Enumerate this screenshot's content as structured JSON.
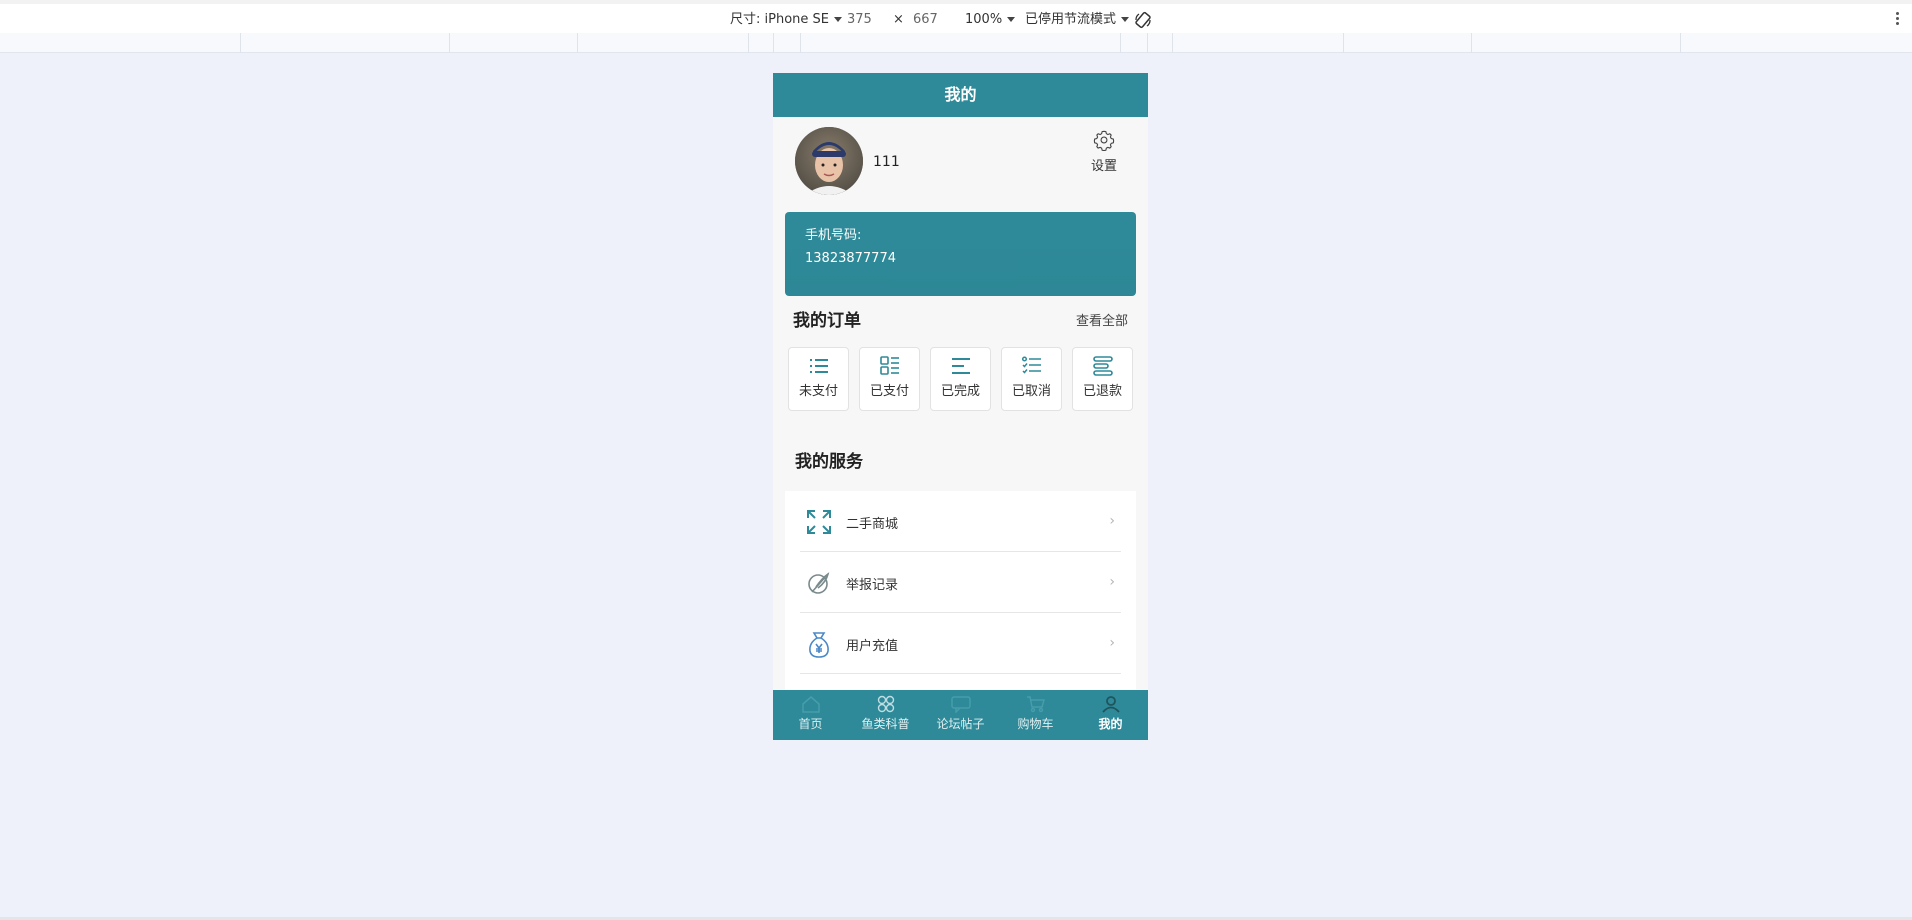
{
  "devtools": {
    "device_label": "尺寸: iPhone SE",
    "width": "375",
    "times": "×",
    "height": "667",
    "zoom": "100%",
    "throttle": "已停用节流模式",
    "rotate_icon": "rotate-icon",
    "more_icon": "kebab-menu-icon"
  },
  "page": {
    "title": "我的",
    "username": "111",
    "settings_label": "设置",
    "phone_label": "手机号码:",
    "phone_value": "13823877774",
    "orders": {
      "title": "我的订单",
      "view_all": "查看全部",
      "items": [
        {
          "label": "未支付",
          "icon": "list-icon"
        },
        {
          "label": "已支付",
          "icon": "grid-list-icon"
        },
        {
          "label": "已完成",
          "icon": "align-left-icon"
        },
        {
          "label": "已取消",
          "icon": "checklist-icon"
        },
        {
          "label": "已退款",
          "icon": "stack-icon"
        }
      ]
    },
    "services": {
      "title": "我的服务",
      "items": [
        {
          "label": "二手商城",
          "icon": "expand-icon"
        },
        {
          "label": "举报记录",
          "icon": "feather-pen-icon"
        },
        {
          "label": "用户充值",
          "icon": "money-bag-icon"
        }
      ]
    },
    "tabbar": [
      {
        "label": "首页",
        "icon": "home-icon"
      },
      {
        "label": "鱼类科普",
        "icon": "clover-icon"
      },
      {
        "label": "论坛帖子",
        "icon": "chat-icon"
      },
      {
        "label": "购物车",
        "icon": "cart-icon"
      },
      {
        "label": "我的",
        "icon": "user-icon",
        "active": true
      }
    ]
  },
  "colors": {
    "primary": "#2e8a99",
    "background": "#eef1f9"
  }
}
